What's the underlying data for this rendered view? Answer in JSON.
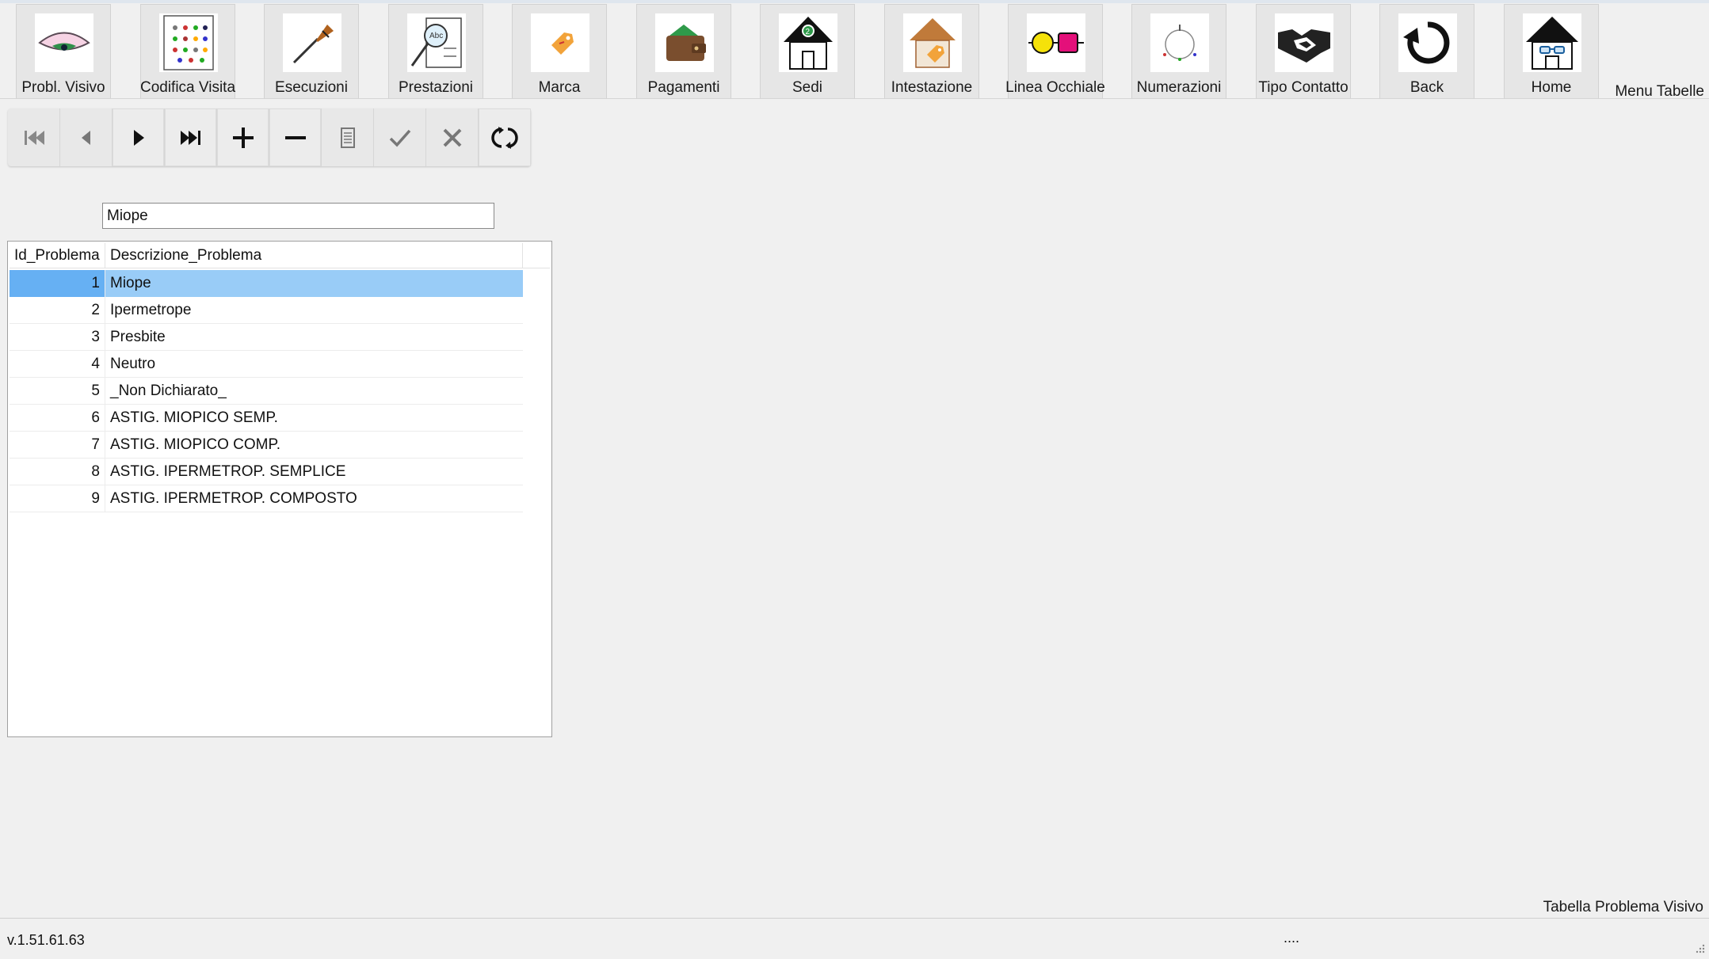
{
  "ribbon": {
    "buttons": [
      {
        "label": "Probl. Visivo",
        "icon": "eye-icon"
      },
      {
        "label": "Codifica Visita",
        "icon": "eye-chart-icon"
      },
      {
        "label": "Esecuzioni",
        "icon": "screwdriver-icon"
      },
      {
        "label": "Prestazioni",
        "icon": "magnifier-document-icon"
      },
      {
        "label": "Marca",
        "icon": "price-tag-icon"
      },
      {
        "label": "Pagamenti",
        "icon": "wallet-icon"
      },
      {
        "label": "Sedi",
        "icon": "branch-house-icon"
      },
      {
        "label": "Intestazione",
        "icon": "house-tag-icon"
      },
      {
        "label": "Linea Occhiale",
        "icon": "glasses-line-icon"
      },
      {
        "label": "Numerazioni",
        "icon": "numbering-circle-icon"
      },
      {
        "label": "Tipo Contatto",
        "icon": "handshake-icon"
      },
      {
        "label": "Back",
        "icon": "back-arrow-icon"
      },
      {
        "label": "Home",
        "icon": "home-icon"
      }
    ],
    "menu_title": "Menu Tabelle"
  },
  "toolbar": {
    "buttons": [
      {
        "name": "first-record-icon"
      },
      {
        "name": "previous-record-icon"
      },
      {
        "name": "next-record-icon"
      },
      {
        "name": "last-record-icon"
      },
      {
        "name": "add-record-icon"
      },
      {
        "name": "delete-record-icon"
      },
      {
        "name": "edit-record-icon"
      },
      {
        "name": "confirm-icon"
      },
      {
        "name": "cancel-icon"
      },
      {
        "name": "refresh-icon"
      }
    ]
  },
  "search": {
    "value": "Miope"
  },
  "grid": {
    "columns": [
      "Id_Problema",
      "Descrizione_Problema"
    ],
    "selected_index": 0,
    "selection_colors": {
      "id_cell": "#66b0f3",
      "desc_cell": "#99ccf7"
    },
    "rows": [
      {
        "id": "1",
        "desc": "Miope"
      },
      {
        "id": "2",
        "desc": "Ipermetrope"
      },
      {
        "id": "3",
        "desc": "Presbite"
      },
      {
        "id": "4",
        "desc": "Neutro"
      },
      {
        "id": "5",
        "desc": "_Non Dichiarato_"
      },
      {
        "id": "6",
        "desc": "ASTIG. MIOPICO SEMP."
      },
      {
        "id": "7",
        "desc": "ASTIG. MIOPICO COMP."
      },
      {
        "id": "8",
        "desc": "ASTIG. IPERMETROP. SEMPLICE"
      },
      {
        "id": "9",
        "desc": "ASTIG. IPERMETROP. COMPOSTO"
      }
    ]
  },
  "footer": {
    "table_caption": "Tabella Problema Visivo",
    "version": "v.1.51.61.63",
    "status_dots": "...."
  }
}
